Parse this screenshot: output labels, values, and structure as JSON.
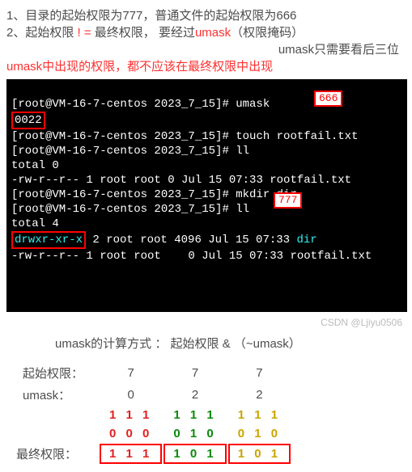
{
  "notes": {
    "line1": "1、目录的起始权限为777，普通文件的起始权限为666",
    "line2_a": "2、起始权限 ",
    "line2_neq": "! =",
    "line2_b": "  最终权限，  要经过",
    "line2_um": "umask",
    "line2_c": "（权限掩码）",
    "line3": "umask只需要看后三位",
    "line4": "umask中出现的权限，都不应该在最终权限中出现"
  },
  "ann": {
    "box666": "666",
    "box777": "777"
  },
  "term": {
    "p1": "[root@VM-16-7-centos 2023_7_15]# ",
    "cmd_umask": "umask",
    "umask_out": "0022",
    "cmd_touch": "touch rootfail.txt",
    "cmd_ll": "ll",
    "total0": "total 0",
    "ls_file1": "-rw-r--r-- 1 root root 0 Jul 15 07:33 rootfail.txt",
    "cmd_mkdir": "mkdir dir",
    "total4": "total 4",
    "ls_dir_perm": "drwxr-xr-x",
    "ls_dir_rest": " 2 root root 4096 Jul 15 07:33 ",
    "ls_dir_name": "dir",
    "ls_file2": "-rw-r--r-- 1 root root    0 Jul 15 07:33 rootfail.txt"
  },
  "calc": {
    "title": "umask的计算方式 ：  起始权限 & （~umask）",
    "row1_label": "起始权限：",
    "row1": [
      "7",
      "7",
      "7"
    ],
    "row2_label": "umask：",
    "row2": [
      "0",
      "2",
      "2"
    ],
    "bits_a": [
      "1 1 1",
      "1 1 1",
      "1 1 1"
    ],
    "bits_b": [
      "0 0 0",
      "0 1 0",
      "0 1 0"
    ],
    "final_label": "最终权限：",
    "final": [
      "1 1 1",
      "1 0 1",
      "1 0 1"
    ]
  },
  "watermark": "CSDN @Ljiyu0506"
}
